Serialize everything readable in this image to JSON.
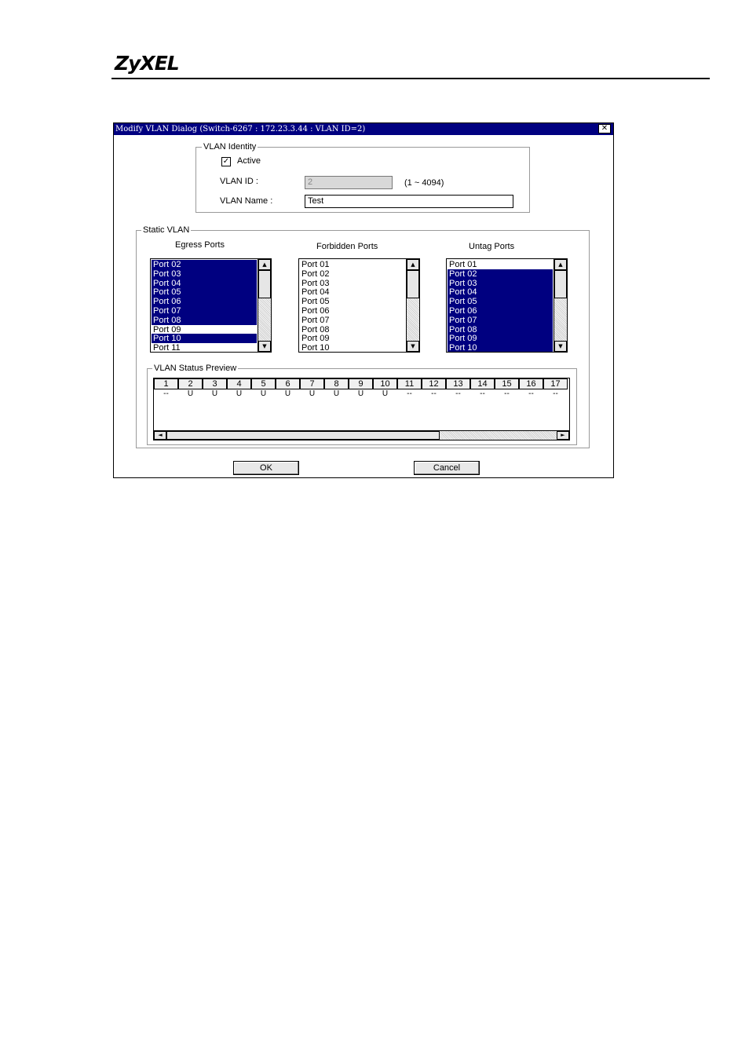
{
  "header": {
    "logo": "ZyXEL"
  },
  "dialog": {
    "title": "Modify VLAN Dialog (Switch-6267 : 172.23.3.44 : VLAN ID=2)",
    "close_glyph": "✕",
    "identity": {
      "group_title": "VLAN Identity",
      "active_label": "Active",
      "active_checked": true,
      "check_glyph": "✓",
      "vlan_id_label": "VLAN ID :",
      "vlan_id_value": "2",
      "vlan_id_range": "(1 ~ 4094)",
      "vlan_name_label": "VLAN Name :",
      "vlan_name_value": "Test"
    },
    "static_vlan": {
      "group_title": "Static VLAN",
      "egress": {
        "label": "Egress Ports",
        "items": [
          "Port 02",
          "Port 03",
          "Port 04",
          "Port 05",
          "Port 06",
          "Port 07",
          "Port 08",
          "Port 09",
          "Port 10",
          "Port 11"
        ],
        "selected": [
          true,
          true,
          true,
          true,
          true,
          true,
          true,
          false,
          true,
          false
        ],
        "focused_index": 7
      },
      "forbidden": {
        "label": "Forbidden Ports",
        "items": [
          "Port 01",
          "Port 02",
          "Port 03",
          "Port 04",
          "Port 05",
          "Port 06",
          "Port 07",
          "Port 08",
          "Port 09",
          "Port 10"
        ],
        "selected": [
          false,
          false,
          false,
          false,
          false,
          false,
          false,
          false,
          false,
          false
        ]
      },
      "untag": {
        "label": "Untag Ports",
        "items": [
          "Port 01",
          "Port 02",
          "Port 03",
          "Port 04",
          "Port 05",
          "Port 06",
          "Port 07",
          "Port 08",
          "Port 09",
          "Port 10"
        ],
        "selected": [
          false,
          true,
          true,
          true,
          true,
          true,
          true,
          true,
          true,
          true
        ]
      },
      "scroll_up": "▲",
      "scroll_down": "▼"
    },
    "preview": {
      "group_title": "VLAN Status Preview",
      "ports": [
        "1",
        "2",
        "3",
        "4",
        "5",
        "6",
        "7",
        "8",
        "9",
        "10",
        "11",
        "12",
        "13",
        "14",
        "15",
        "16",
        "17"
      ],
      "status": [
        "--",
        "U",
        "U",
        "U",
        "U",
        "U",
        "U",
        "U",
        "U",
        "U",
        "--",
        "--",
        "--",
        "--",
        "--",
        "--",
        "--"
      ],
      "scroll_left": "◄",
      "scroll_right": "►"
    },
    "ok_label": "OK",
    "cancel_label": "Cancel"
  },
  "colors": {
    "selection": "#000080",
    "title_bar": "#000080"
  }
}
